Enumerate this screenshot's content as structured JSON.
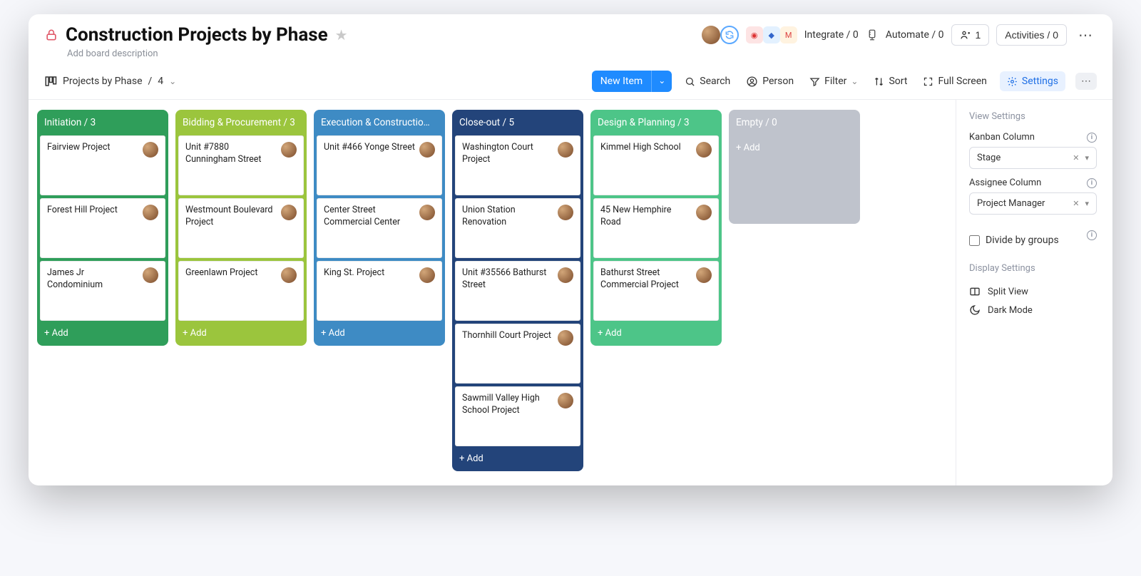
{
  "header": {
    "title": "Construction Projects by Phase",
    "description_placeholder": "Add board description",
    "integrate_label": "Integrate / 0",
    "automate_label": "Automate / 0",
    "invite_label": "1",
    "activities_label": "Activities / 0"
  },
  "subheader": {
    "view_name": "Projects by Phase",
    "view_count": "4",
    "new_item_label": "New Item",
    "search_label": "Search",
    "person_label": "Person",
    "filter_label": "Filter",
    "sort_label": "Sort",
    "fullscreen_label": "Full Screen",
    "settings_label": "Settings"
  },
  "columns": [
    {
      "color": "c-green",
      "title": "Initiation",
      "count": "3",
      "cards": [
        "Fairview Project",
        "Forest Hill Project",
        "James Jr Condominium"
      ]
    },
    {
      "color": "c-lime",
      "title": "Bidding & Procurement",
      "count": "3",
      "cards": [
        "Unit #7880 Cunningham Street",
        "Westmount Boulevard Project",
        "Greenlawn Project"
      ]
    },
    {
      "color": "c-blue",
      "title": "Execution & Constructio…",
      "count": "",
      "cards": [
        "Unit #466 Yonge Street",
        "Center Street Commercial Center",
        "King St. Project"
      ]
    },
    {
      "color": "c-navy",
      "title": "Close-out",
      "count": "5",
      "cards": [
        "Washington Court Project",
        "Union Station Renovation",
        "Unit #35566 Bathurst Street",
        "Thornhill Court Project",
        "Sawmill Valley High School Project"
      ]
    },
    {
      "color": "c-mint",
      "title": "Design & Planning",
      "count": "3",
      "cards": [
        "Kimmel High School",
        "45 New Hemphire Road",
        "Bathurst Street Commercial Project"
      ]
    },
    {
      "color": "c-gray",
      "title": "Empty",
      "count": "0",
      "cards": []
    }
  ],
  "add_card_label": "+ Add",
  "settings_panel": {
    "view_settings_heading": "View Settings",
    "kanban_column_label": "Kanban Column",
    "kanban_column_value": "Stage",
    "assignee_column_label": "Assignee Column",
    "assignee_column_value": "Project Manager",
    "divide_groups_label": "Divide by groups",
    "display_settings_heading": "Display Settings",
    "split_view_label": "Split View",
    "dark_mode_label": "Dark Mode"
  }
}
